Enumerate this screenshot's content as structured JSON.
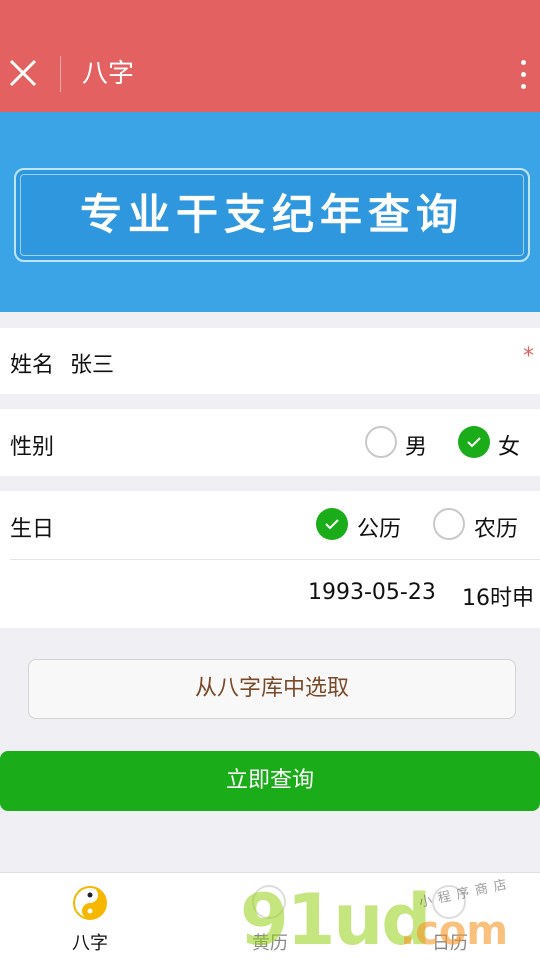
{
  "topbar": {
    "title": "八字",
    "color": "#e36161"
  },
  "banner": {
    "text": "专业干支纪年查询",
    "color": "#3aa4e6"
  },
  "form": {
    "name": {
      "label": "姓名",
      "value": "张三",
      "required_mark": "*"
    },
    "gender": {
      "label": "性别",
      "options": [
        {
          "label": "男",
          "checked": false
        },
        {
          "label": "女",
          "checked": true
        }
      ]
    },
    "birthday": {
      "label": "生日",
      "calendar_options": [
        {
          "label": "公历",
          "checked": true
        },
        {
          "label": "农历",
          "checked": false
        }
      ],
      "date": "1993-05-23",
      "hour": "16时申"
    }
  },
  "buttons": {
    "pick_from_library": "从八字库中选取",
    "query_now": "立即查询",
    "accent": "#1aad19"
  },
  "tabbar": {
    "tabs": [
      {
        "label": "八字",
        "icon": "yin-yang-icon",
        "active": true
      },
      {
        "label": "黄历",
        "icon": "almanac-icon",
        "active": false
      },
      {
        "label": "日历",
        "icon": "calendar-icon",
        "active": false
      }
    ]
  },
  "watermark": {
    "main": "91ud",
    "suffix": ".com",
    "small": "小程序商店"
  }
}
